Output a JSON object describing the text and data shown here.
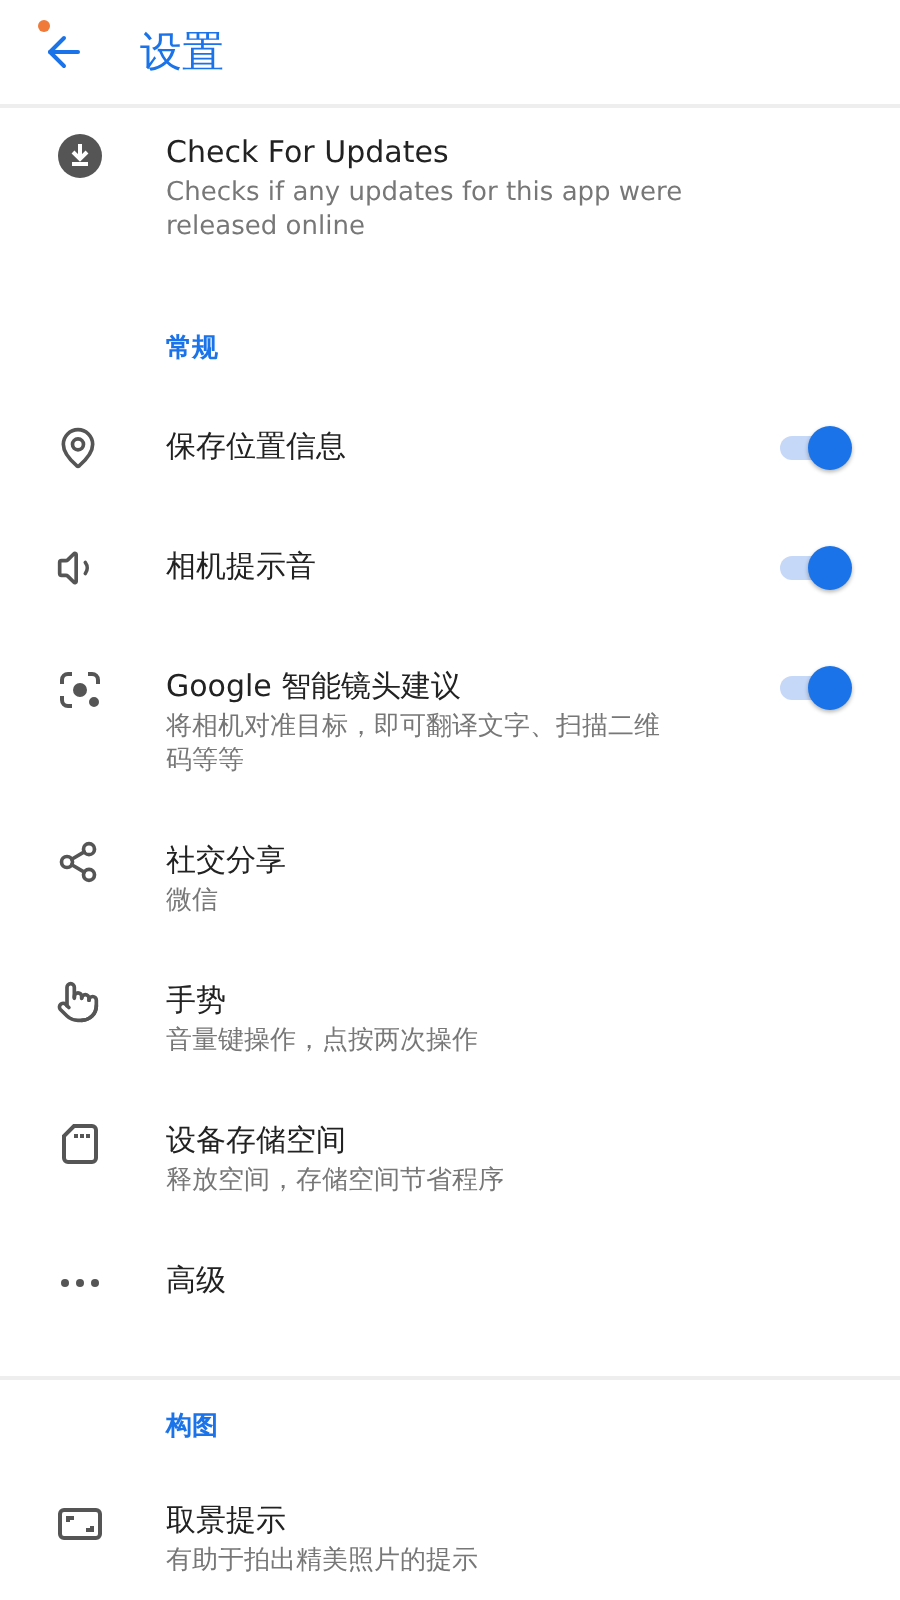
{
  "header": {
    "title": "设置",
    "notification_dot": true
  },
  "sections": [
    {
      "items": [
        {
          "title": "Check For Updates",
          "subtitle": "Checks if any updates for this app were released online"
        }
      ]
    },
    {
      "heading": "常规",
      "items": [
        {
          "title": "保存位置信息",
          "kind": "toggle",
          "on": true
        },
        {
          "title": "相机提示音",
          "kind": "toggle",
          "on": true
        },
        {
          "title": "Google 智能镜头建议",
          "subtitle": "将相机对准目标，即可翻译文字、扫描二维码等等",
          "kind": "toggle",
          "on": true
        },
        {
          "title": "社交分享",
          "subtitle": "微信"
        },
        {
          "title": "手势",
          "subtitle": "音量键操作，点按两次操作"
        },
        {
          "title": "设备存储空间",
          "subtitle": "释放空间，存储空间节省程序"
        },
        {
          "title": "高级"
        }
      ]
    },
    {
      "heading": "构图",
      "items": [
        {
          "title": "取景提示",
          "subtitle": "有助于拍出精美照片的提示"
        }
      ]
    }
  ]
}
